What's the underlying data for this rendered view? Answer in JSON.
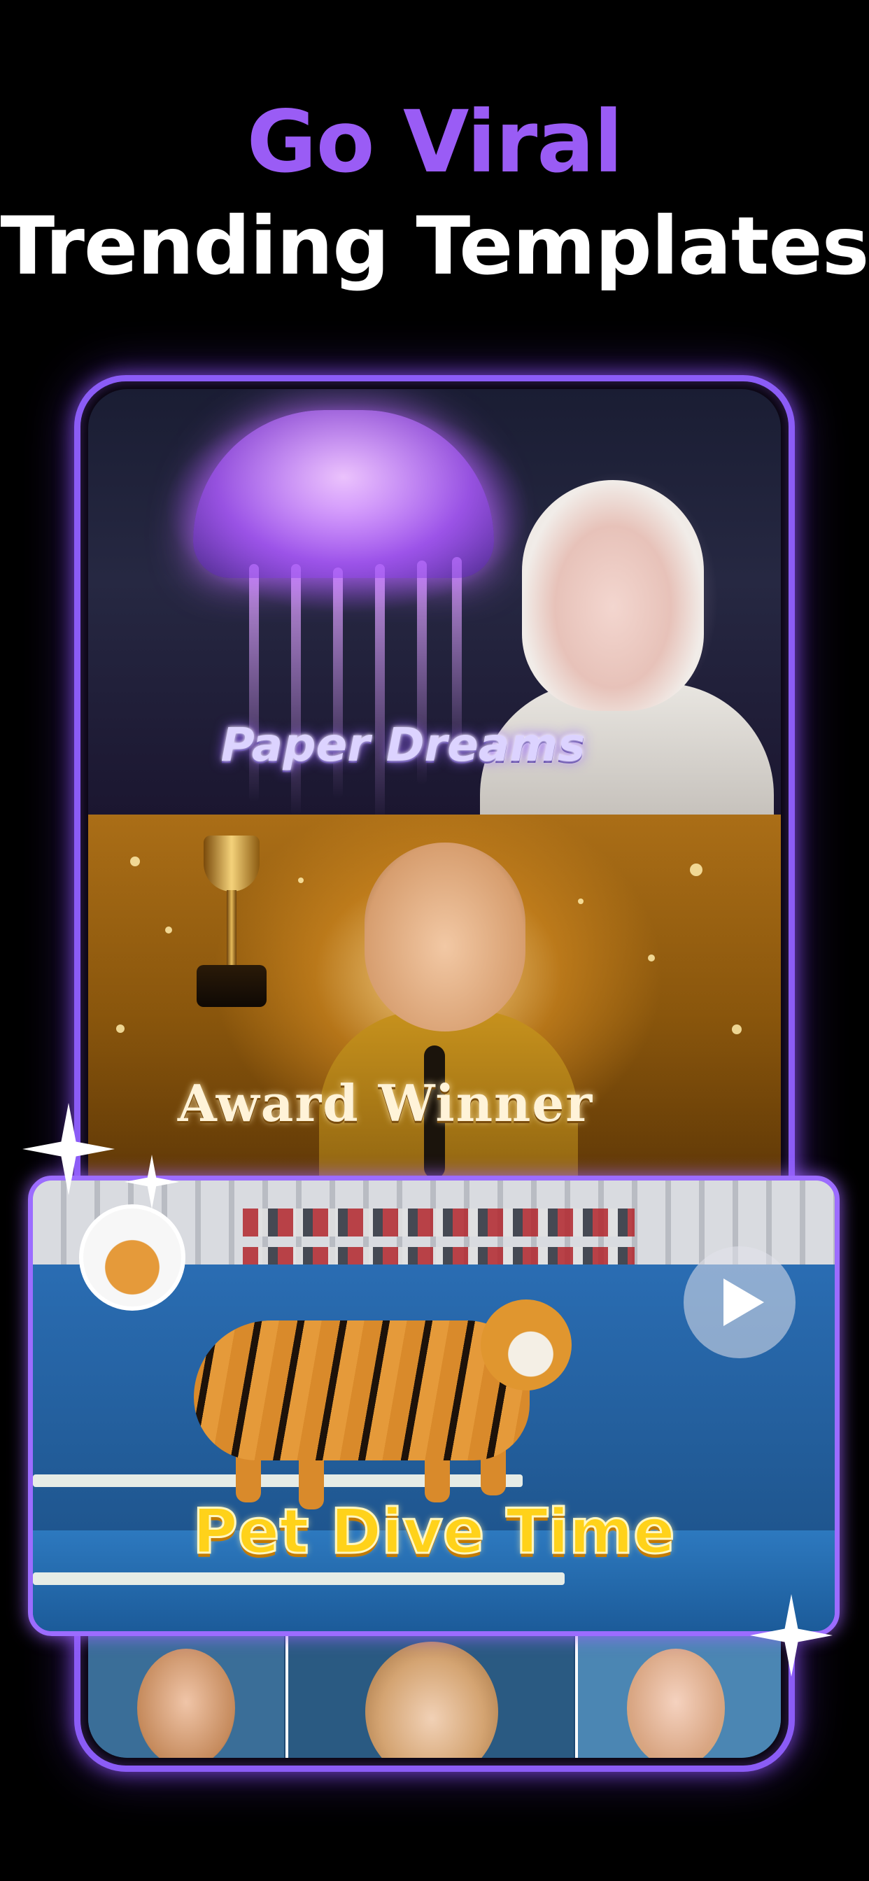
{
  "headline": {
    "accent": "Go Viral",
    "main": "Trending Templates"
  },
  "colors": {
    "accent": "#8b5cf6",
    "feature_border": "#9c6cff",
    "feature_title": "#ffd21a"
  },
  "templates": [
    {
      "title": "Paper Dreams"
    },
    {
      "title": "Award Winner"
    }
  ],
  "feature_template": {
    "title": "Pet Dive Time",
    "play_icon": "play-icon"
  }
}
